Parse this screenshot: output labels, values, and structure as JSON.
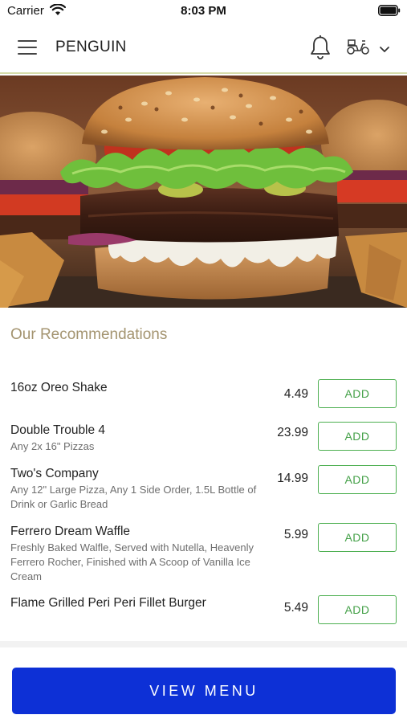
{
  "status_bar": {
    "carrier": "Carrier",
    "time": "8:03 PM"
  },
  "header": {
    "menu_icon": "hamburger-menu-icon",
    "brand": "PENGUIN",
    "notification_icon": "bell-icon",
    "delivery_icon": "scooter-icon",
    "dropdown_icon": "chevron-down-icon"
  },
  "hero": {
    "image": "burger-photo"
  },
  "recommendations": {
    "title": "Our Recommendations",
    "items": [
      {
        "name": "16oz Oreo Shake",
        "description": "",
        "price": "4.49",
        "add_label": "ADD"
      },
      {
        "name": "Double Trouble 4",
        "description": "Any 2x 16\" Pizzas",
        "price": "23.99",
        "add_label": "ADD"
      },
      {
        "name": "Two's Company",
        "description": "Any 12\"  Large Pizza, Any 1 Side Order, 1.5L Bottle of Drink or Garlic Bread",
        "price": "14.99",
        "add_label": "ADD"
      },
      {
        "name": "Ferrero Dream Waffle",
        "description": "Freshly Baked Walfle, Served with Nutella, Heavenly Ferrero Rocher, Finished with A Scoop of Vanilla Ice Cream",
        "price": "5.99",
        "add_label": "ADD"
      },
      {
        "name": "Flame Grilled Peri Peri Fillet Burger",
        "description": "",
        "price": "5.49",
        "add_label": "ADD"
      }
    ]
  },
  "footer": {
    "view_menu_label": "VIEW MENU"
  },
  "colors": {
    "accent_blue": "#0d30d6",
    "add_green": "#43a047",
    "section_title": "#a49470"
  }
}
